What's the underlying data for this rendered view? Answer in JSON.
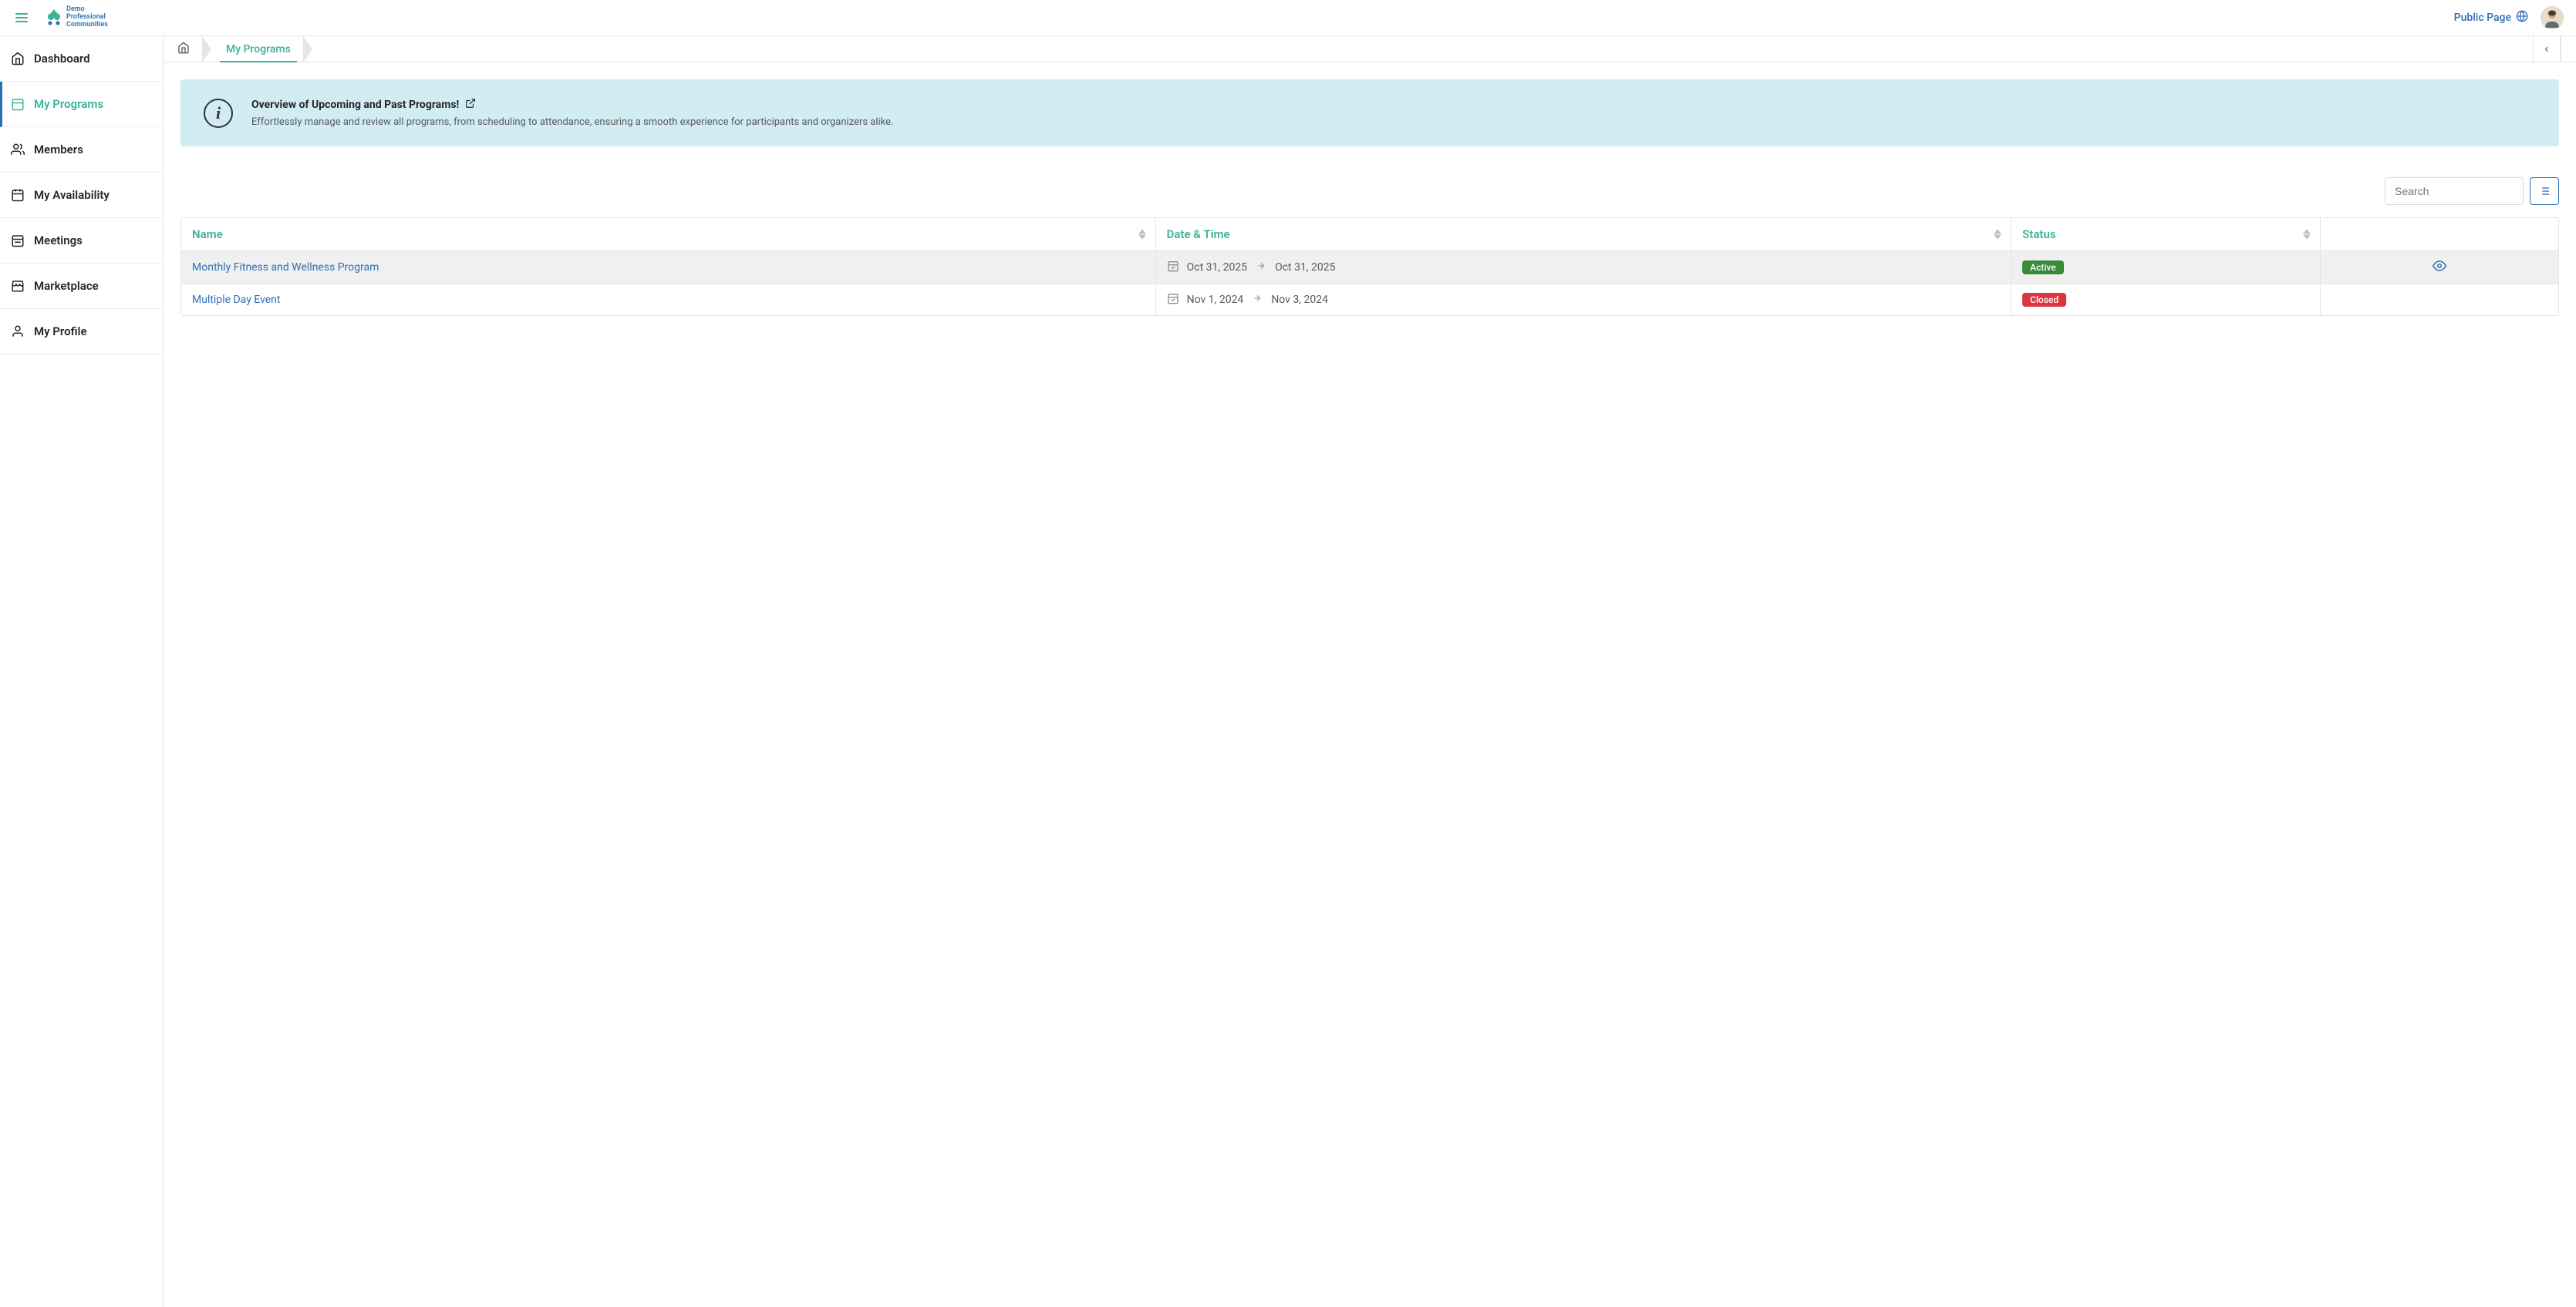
{
  "header": {
    "logo_line1": "Demo",
    "logo_line2": "Professional",
    "logo_line3": "Communities",
    "public_page": "Public Page"
  },
  "sidebar": {
    "items": [
      {
        "label": "Dashboard",
        "icon": "home",
        "active": false
      },
      {
        "label": "My Programs",
        "icon": "calendar",
        "active": true
      },
      {
        "label": "Members",
        "icon": "users",
        "active": false
      },
      {
        "label": "My Availability",
        "icon": "calendar-alt",
        "active": false
      },
      {
        "label": "Meetings",
        "icon": "calendar-lines",
        "active": false
      },
      {
        "label": "Marketplace",
        "icon": "store",
        "active": false
      },
      {
        "label": "My Profile",
        "icon": "user",
        "active": false
      }
    ]
  },
  "breadcrumb": {
    "current": "My Programs"
  },
  "banner": {
    "title": "Overview of Upcoming and Past Programs!",
    "description": "Effortlessly manage and review all programs, from scheduling to attendance, ensuring a smooth experience for participants and organizers alike."
  },
  "toolbar": {
    "search_placeholder": "Search"
  },
  "table": {
    "columns": {
      "name": "Name",
      "date": "Date & Time",
      "status": "Status"
    },
    "rows": [
      {
        "name": "Monthly Fitness and Wellness Program",
        "start": "Oct 31, 2025",
        "end": "Oct 31, 2025",
        "status": "Active",
        "status_class": "active",
        "hover": true,
        "show_eye": true
      },
      {
        "name": "Multiple Day Event",
        "start": "Nov 1, 2024",
        "end": "Nov 3, 2024",
        "status": "Closed",
        "status_class": "closed",
        "hover": false,
        "show_eye": false
      }
    ]
  }
}
